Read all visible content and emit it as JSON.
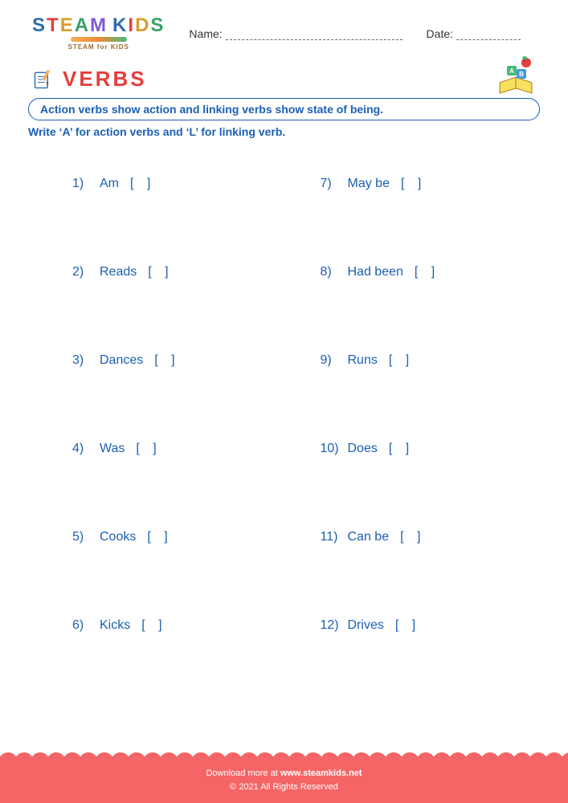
{
  "header": {
    "logo_main": "STEAM KIDS",
    "logo_sub": "STEAM for KIDS",
    "name_label": "Name:",
    "date_label": "Date:"
  },
  "title": "VERBS",
  "instruction_box": "Action verbs show action and linking verbs show state of being.",
  "instruction_line": "Write ‘A’ for action verbs and ‘L’ for linking verb.",
  "bracket": "[     ]",
  "questions_left": [
    {
      "num": "1)",
      "word": "Am"
    },
    {
      "num": "2)",
      "word": "Reads"
    },
    {
      "num": "3)",
      "word": "Dances"
    },
    {
      "num": "4)",
      "word": "Was"
    },
    {
      "num": "5)",
      "word": "Cooks"
    },
    {
      "num": "6)",
      "word": "Kicks"
    }
  ],
  "questions_right": [
    {
      "num": "7)",
      "word": "May be"
    },
    {
      "num": "8)",
      "word": "Had been"
    },
    {
      "num": "9)",
      "word": "Runs"
    },
    {
      "num": "10)",
      "word": "Does"
    },
    {
      "num": "11)",
      "word": "Can be"
    },
    {
      "num": "12)",
      "word": "Drives"
    }
  ],
  "footer": {
    "line1_pre": "Download more at ",
    "url": "www.steamkids.net",
    "line2": "©  2021 All Rights Reserved"
  }
}
